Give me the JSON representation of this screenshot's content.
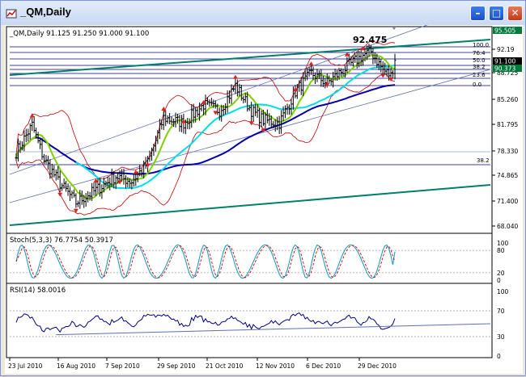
{
  "window": {
    "title": "_QM,Daily",
    "minimize_label": "–",
    "maximize_label": "□",
    "close_label": "✕"
  },
  "colors": {
    "bull_bear_bars": "#000000",
    "sma_fast": "#7fd000",
    "sma_mid": "#00dde8",
    "sma_slow": "#0000aa",
    "bollinger": "#c00000",
    "channel_main": "#007f6a",
    "fib_lines": "#000080",
    "stoch_main": "#1f9fbf",
    "stoch_signal": "#cc0000",
    "rsi_line": "#000080",
    "price_label_bg": "#000000",
    "green_label_bg": "#007a3a"
  },
  "main_panel": {
    "header": "_QM,Daily  91.125  91.250  91.000  91.100",
    "peak_label": "92.475",
    "price_scale": [
      "92.19",
      "88.725",
      "85.260",
      "81.795",
      "78.330",
      "74.865",
      "71.400",
      "68.040"
    ],
    "price_label_top": "95.505",
    "price_label_current": "91.100",
    "price_label_green": "90.373",
    "fib_levels": [
      "100.0",
      "76.4",
      "50.0",
      "38.2",
      "23.6",
      "0.0"
    ],
    "fib_label_lower": "38.2"
  },
  "stoch_panel": {
    "header": "Stoch(5,3,3)  76.7754  50.3917",
    "scale": [
      "100",
      "80",
      "20",
      "0"
    ]
  },
  "rsi_panel": {
    "header": "RSI(14)  58.0016",
    "scale": [
      "100",
      "70",
      "30",
      "0"
    ]
  },
  "time_axis": [
    "23 Jul 2010",
    "16 Aug 2010",
    "7 Sep 2010",
    "29 Sep 2010",
    "21 Oct 2010",
    "12 Nov 2010",
    "6 Dec 2010",
    "29 Dec 2010"
  ],
  "chart_data": {
    "type": "line",
    "title": "_QM,Daily",
    "ohlc_last": {
      "open": 91.125,
      "high": 91.25,
      "low": 91.0,
      "close": 91.1
    },
    "x": [
      "23 Jul 2010",
      "16 Aug 2010",
      "7 Sep 2010",
      "29 Sep 2010",
      "21 Oct 2010",
      "12 Nov 2010",
      "6 Dec 2010",
      "29 Dec 2010"
    ],
    "ylim": [
      68.04,
      93.5
    ],
    "series": [
      {
        "name": "",
        "values": [
          78.5,
          72.2,
          75.6,
          83.5,
          84.5,
          82.0,
          88.8,
          89.9
        ]
      }
    ],
    "stochastic": {
      "main": 76.7754,
      "signal": 50.3917,
      "levels": [
        80,
        20
      ]
    },
    "rsi": {
      "value": 58.0016,
      "levels": [
        70,
        30
      ]
    },
    "peak": 92.475
  }
}
